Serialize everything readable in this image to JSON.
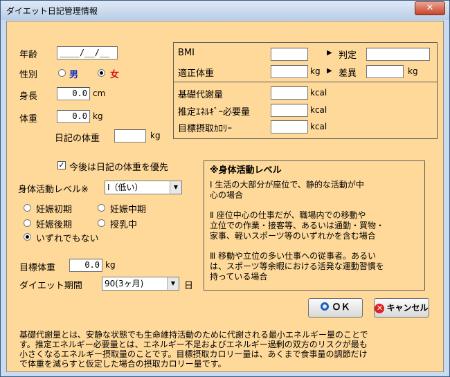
{
  "window": {
    "title": "ダイエット日記管理情報",
    "close_label": "✕"
  },
  "profile": {
    "age_label": "年齢",
    "age_value": "____/__/__",
    "gender_label": "性別",
    "male_label": "男",
    "female_label": "女",
    "height_label": "身長",
    "height_value": "0.0",
    "height_unit": "cm",
    "weight_label": "体重",
    "weight_value": "0.0",
    "weight_unit": "kg",
    "diary_weight_label": "日記の体重",
    "diary_weight_value": "",
    "diary_weight_unit": "kg",
    "prefer_diary_label": "今後は日記の体重を優先"
  },
  "results": {
    "bmi_label": "BMI",
    "bmi_value": "",
    "judgement_label": "判定",
    "judgement_value": "",
    "ideal_weight_label": "適正体重",
    "ideal_weight_value": "",
    "ideal_weight_unit": "kg",
    "difference_label": "差異",
    "difference_value": "",
    "difference_unit": "kg",
    "bmr_label": "基礎代謝量",
    "bmr_value": "",
    "bmr_unit": "kcal",
    "eer_label": "推定ｴﾈﾙｷﾞｰ必要量",
    "eer_value": "",
    "eer_unit": "kcal",
    "target_intake_label": "目標摂取ｶﾛﾘｰ",
    "target_intake_value": "",
    "target_intake_unit": "kcal"
  },
  "activity": {
    "label": "身体活動レベル※",
    "selected": "Ⅰ（低い）",
    "options": {
      "early": "妊娠初期",
      "middle": "妊娠中期",
      "late": "妊娠後期",
      "lactation": "授乳中",
      "none": "いずれでもない"
    }
  },
  "goal": {
    "target_weight_label": "目標体重",
    "target_weight_value": "0.0",
    "target_weight_unit": "kg",
    "period_label": "ダイエット期間",
    "period_value": "90(3ヶ月)",
    "period_unit": "日"
  },
  "activity_info": {
    "title": "※身体活動レベル",
    "level1": [
      "Ⅰ 生活の大部分が座位で、静的な活動が中",
      "心の場合"
    ],
    "level2": [
      "Ⅱ 座位中心の仕事だが、職場内での移動や",
      "立位での作業・接客等、あるいは通勤・買物・",
      "家事、軽いスポーツ等のいずれかを含む場合"
    ],
    "level3": [
      "Ⅲ 移動や立位の多い仕事への従事者。あるい",
      "は、スポーツ等余暇における活発な運動習慣を",
      "持っている場合"
    ]
  },
  "buttons": {
    "ok": "ＯＫ",
    "cancel": "キャンセル"
  },
  "footnote": [
    "基礎代謝量とは、安静な状態でも生命維持活動のために代謝される最小エネルギー量のことで",
    "す。推定エネルギー必要量とは、エネルギー不足およびエネルギー過剰の双方のリスクが最も",
    "小さくなるエネルギー摂取量のことです。目標摂取カロリー量は、あくまで食事量の調節だけ",
    "で体重を減らすと仮定した場合の摂取カロリー量です。"
  ]
}
